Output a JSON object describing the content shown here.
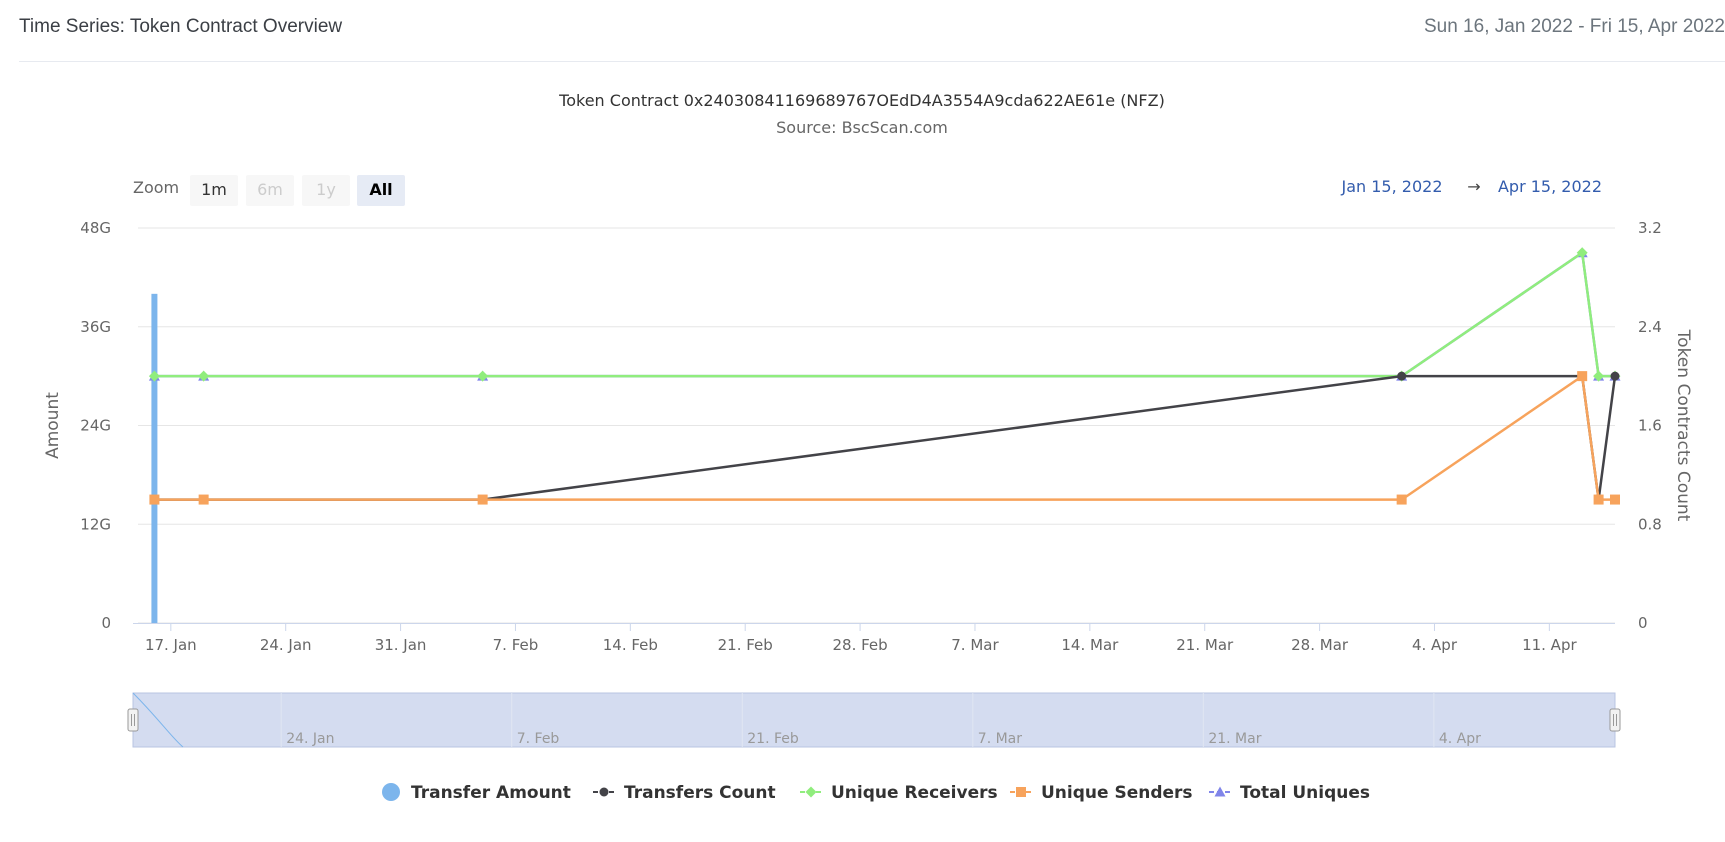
{
  "header": {
    "title": "Time Series: Token Contract Overview",
    "date_range": "Sun 16, Jan 2022 - Fri 15, Apr 2022"
  },
  "zoom": {
    "label": "Zoom",
    "buttons": [
      {
        "label": "1m",
        "state": "enabled"
      },
      {
        "label": "6m",
        "state": "disabled"
      },
      {
        "label": "1y",
        "state": "disabled"
      },
      {
        "label": "All",
        "state": "selected"
      }
    ]
  },
  "range_selector": {
    "from": "Jan 15, 2022",
    "arrow": "→",
    "to": "Apr 15, 2022"
  },
  "navigator": {
    "tick_labels": [
      "24. Jan",
      "7. Feb",
      "21. Feb",
      "7. Mar",
      "21. Mar",
      "4. Apr"
    ]
  },
  "colors": {
    "transfer_amount": "#7cb5ec",
    "transfers_count": "#434348",
    "unique_receivers": "#90ed7d",
    "unique_senders": "#f7a35c",
    "total_uniques": "#8085e9",
    "navigator_fill": "#d4dcf0"
  },
  "chart_data": {
    "type": "line",
    "title": "Token Contract 0x24030841169689767OEdD4A3554A9cda622AE61e (NFZ)",
    "subtitle": "Source: BscScan.com",
    "xlabel": "",
    "ylabel": "Amount",
    "y2label": "Token Contracts Count",
    "x_range": [
      "2022-01-15",
      "2022-04-15"
    ],
    "x_ticks": [
      "17. Jan",
      "24. Jan",
      "31. Jan",
      "7. Feb",
      "14. Feb",
      "21. Feb",
      "28. Feb",
      "7. Mar",
      "14. Mar",
      "21. Mar",
      "28. Mar",
      "4. Apr",
      "11. Apr"
    ],
    "ylim": [
      0,
      48
    ],
    "y_ticks": [
      "0",
      "12G",
      "24G",
      "36G",
      "48G"
    ],
    "y2lim": [
      0,
      3.2
    ],
    "y2_ticks": [
      "0",
      "0.8",
      "1.6",
      "2.4",
      "3.2"
    ],
    "grid": true,
    "legend_position": "bottom",
    "series": [
      {
        "name": "Transfer Amount",
        "type": "column",
        "axis": "left",
        "unit": "G",
        "x": [
          "2022-01-16"
        ],
        "y": [
          40
        ]
      },
      {
        "name": "Transfers Count",
        "type": "line",
        "axis": "right",
        "x": [
          "2022-01-16",
          "2022-01-19",
          "2022-02-05",
          "2022-04-02",
          "2022-04-13",
          "2022-04-14",
          "2022-04-15"
        ],
        "y": [
          1,
          1,
          1,
          2,
          2,
          1,
          2
        ]
      },
      {
        "name": "Unique Receivers",
        "type": "line",
        "axis": "right",
        "x": [
          "2022-01-16",
          "2022-01-19",
          "2022-02-05",
          "2022-04-02",
          "2022-04-13",
          "2022-04-14",
          "2022-04-15"
        ],
        "y": [
          2,
          2,
          2,
          2,
          3,
          2,
          2
        ]
      },
      {
        "name": "Unique Senders",
        "type": "line",
        "axis": "right",
        "x": [
          "2022-01-16",
          "2022-01-19",
          "2022-02-05",
          "2022-04-02",
          "2022-04-13",
          "2022-04-14",
          "2022-04-15"
        ],
        "y": [
          1,
          1,
          1,
          1,
          2,
          1,
          1
        ]
      },
      {
        "name": "Total Uniques",
        "type": "line",
        "axis": "right",
        "x": [
          "2022-01-16",
          "2022-01-19",
          "2022-02-05",
          "2022-04-02",
          "2022-04-13",
          "2022-04-14",
          "2022-04-15"
        ],
        "y": [
          2,
          2,
          2,
          2,
          3,
          2,
          2
        ]
      }
    ]
  }
}
